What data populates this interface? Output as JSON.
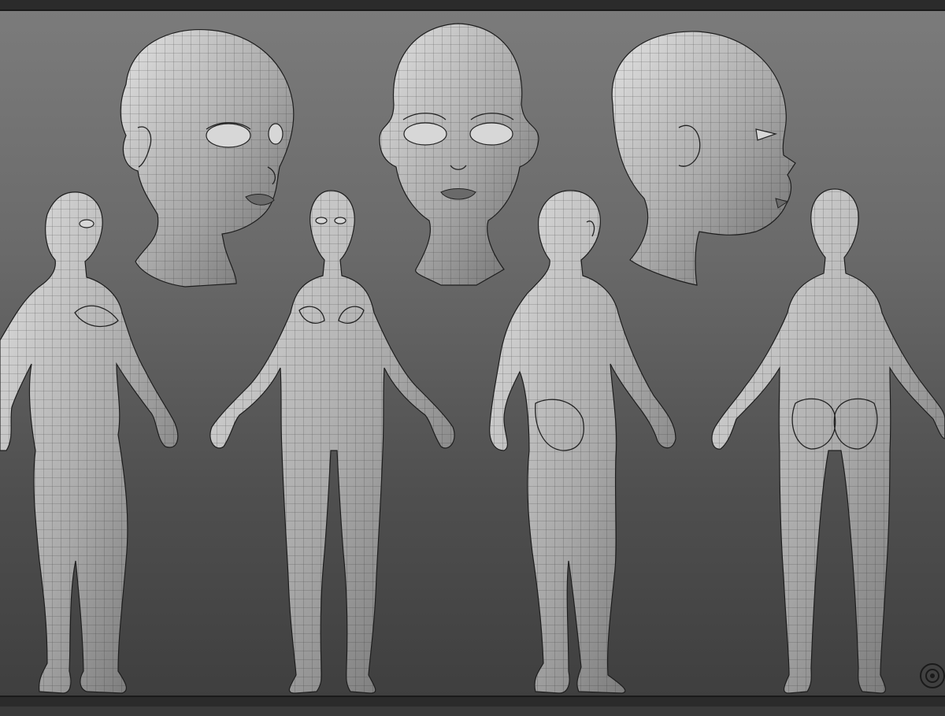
{
  "scene": {
    "subject": "",
    "views": [
      {
        "id": "head-three-quarter"
      },
      {
        "id": "head-front"
      },
      {
        "id": "head-side"
      },
      {
        "id": "body-three-quarter"
      },
      {
        "id": "body-front"
      },
      {
        "id": "body-back-three-quarter"
      },
      {
        "id": "body-back"
      }
    ],
    "colors": {
      "background_top": "#7b7b7b",
      "background_bottom": "#3f3f3f",
      "clay_light": "#d9d9d9",
      "clay_dark": "#6e6e6e",
      "wire": "#222222",
      "border": "#2b2b2b"
    },
    "icons": [
      "viewport-navigation-icon"
    ]
  }
}
